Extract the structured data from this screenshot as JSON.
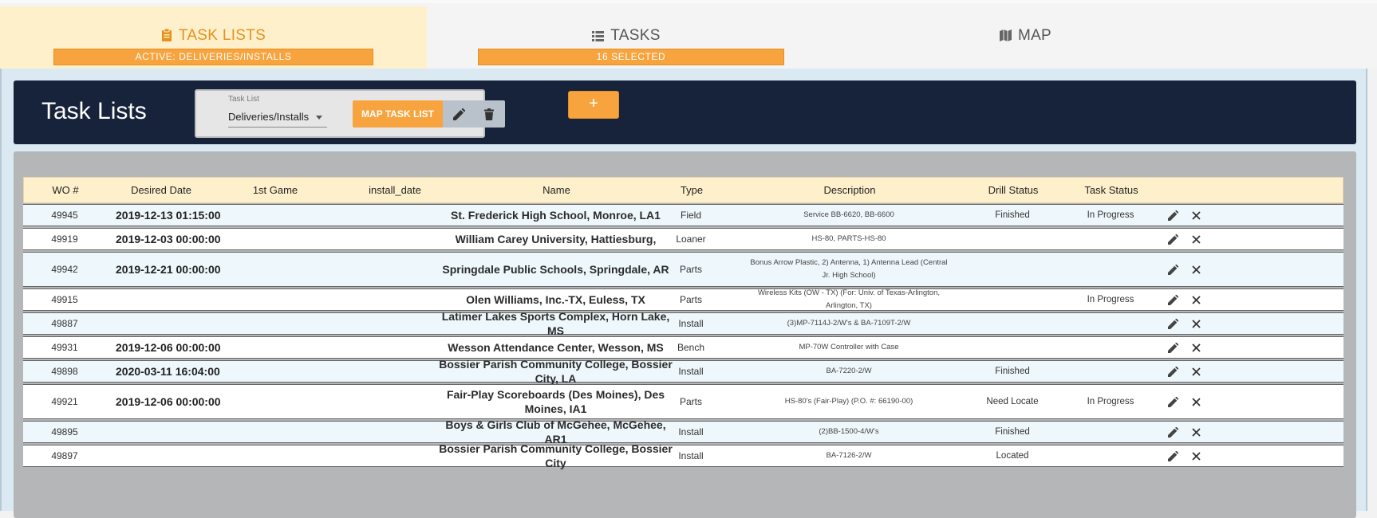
{
  "tabs": [
    {
      "label": "TASK LISTS",
      "badge": "ACTIVE: DELIVERIES/INSTALLS",
      "icon": "clipboard-icon"
    },
    {
      "label": "TASKS",
      "badge": "16 SELECTED",
      "icon": "list-icon"
    },
    {
      "label": "MAP",
      "badge": "",
      "icon": "map-icon"
    }
  ],
  "header": {
    "title": "Task Lists",
    "task_list_label": "Task List",
    "task_list_value": "Deliveries/Installs",
    "map_button": "MAP TASK LIST",
    "add_button": "+"
  },
  "table": {
    "columns": [
      "WO #",
      "Desired Date",
      "1st Game",
      "install_date",
      "Name",
      "Type",
      "Description",
      "Drill Status",
      "Task Status"
    ],
    "rows": [
      {
        "wo": "49945",
        "date": "2019-12-13 01:15:00",
        "first_game": "",
        "install_date": "",
        "name": "St. Frederick High School, Monroe, LA1",
        "type": "Field",
        "desc": "Service BB-6620, BB-6600",
        "drill": "Finished",
        "status": "In Progress"
      },
      {
        "wo": "49919",
        "date": "2019-12-03 00:00:00",
        "first_game": "",
        "install_date": "",
        "name": "William Carey University, Hattiesburg,",
        "type": "Loaner",
        "desc": "HS-80, PARTS-HS-80",
        "drill": "",
        "status": ""
      },
      {
        "wo": "49942",
        "date": "2019-12-21 00:00:00",
        "first_game": "",
        "install_date": "",
        "name": "Springdale Public Schools, Springdale, AR",
        "type": "Parts",
        "desc": "Bonus Arrow Plastic, 2) Antenna, 1) Antenna Lead (Central Jr. High School)",
        "drill": "",
        "status": ""
      },
      {
        "wo": "49915",
        "date": "",
        "first_game": "",
        "install_date": "",
        "name": "Olen Williams, Inc.-TX, Euless, TX",
        "type": "Parts",
        "desc": "Wireless Kits (OW - TX) (For: Univ. of Texas-Arlington, Arlington, TX)",
        "drill": "",
        "status": "In Progress"
      },
      {
        "wo": "49887",
        "date": "",
        "first_game": "",
        "install_date": "",
        "name": "Latimer Lakes Sports Complex, Horn Lake, MS",
        "type": "Install",
        "desc": "(3)MP-7114J-2/W's & BA-7109T-2/W",
        "drill": "",
        "status": ""
      },
      {
        "wo": "49931",
        "date": "2019-12-06 00:00:00",
        "first_game": "",
        "install_date": "",
        "name": "Wesson Attendance Center, Wesson, MS",
        "type": "Bench",
        "desc": "MP-70W Controller with Case",
        "drill": "",
        "status": ""
      },
      {
        "wo": "49898",
        "date": "2020-03-11 16:04:00",
        "first_game": "",
        "install_date": "",
        "name": "Bossier Parish Community College, Bossier City, LA",
        "type": "Install",
        "desc": "BA-7220-2/W",
        "drill": "Finished",
        "status": ""
      },
      {
        "wo": "49921",
        "date": "2019-12-06 00:00:00",
        "first_game": "",
        "install_date": "",
        "name": "Fair-Play Scoreboards (Des Moines), Des Moines, IA1",
        "type": "Parts",
        "desc": "HS-80's (Fair-Play) (P.O. #: 66190-00)",
        "drill": "Need Locate",
        "status": "In Progress"
      },
      {
        "wo": "49895",
        "date": "",
        "first_game": "",
        "install_date": "",
        "name": "Boys & Girls Club of McGehee, McGehee, AR1",
        "type": "Install",
        "desc": "(2)BB-1500-4/W's",
        "drill": "Finished",
        "status": ""
      },
      {
        "wo": "49897",
        "date": "",
        "first_game": "",
        "install_date": "",
        "name": "Bossier Parish Community College, Bossier City",
        "type": "Install",
        "desc": "BA-7126-2/W",
        "drill": "Located",
        "status": ""
      }
    ]
  },
  "colors": {
    "accent": "#f8a43e",
    "header_bg": "#17233a",
    "active_tab_bg": "#fff0cc"
  }
}
